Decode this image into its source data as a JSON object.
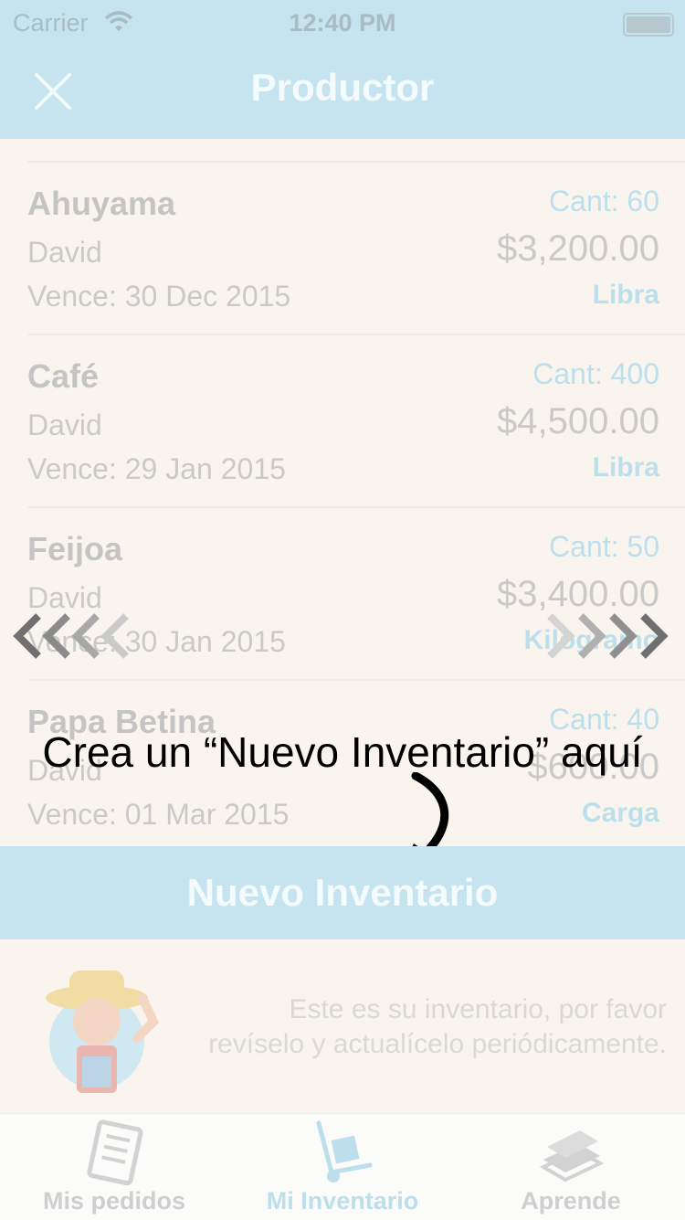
{
  "status_bar": {
    "carrier": "Carrier",
    "time": "12:40 PM"
  },
  "nav": {
    "title": "Productor"
  },
  "inventory": [
    {
      "name": "Ahuyama",
      "owner": "David",
      "expires": "Vence: 30 Dec 2015",
      "quantity": "Cant: 60",
      "price": "$3,200.00",
      "unit": "Libra"
    },
    {
      "name": "Café",
      "owner": "David",
      "expires": "Vence: 29 Jan 2015",
      "quantity": "Cant: 400",
      "price": "$4,500.00",
      "unit": "Libra"
    },
    {
      "name": "Feijoa",
      "owner": "David",
      "expires": "Vence: 30 Jan 2015",
      "quantity": "Cant: 50",
      "price": "$3,400.00",
      "unit": "Kilogramo"
    },
    {
      "name": "Papa Betina",
      "owner": "David",
      "expires": "Vence: 01 Mar 2015",
      "quantity": "Cant: 40",
      "price": "$600.00",
      "unit": "Carga"
    }
  ],
  "tutorial": {
    "hint": "Crea un “Nuevo Inventario” aquí"
  },
  "new_inventory_button": "Nuevo Inventario",
  "info_message": "Este es su inventario, por favor revíselo y actualícelo periódicamente.",
  "tabs": [
    {
      "label": "Mis pedidos",
      "icon": "orders-icon",
      "active": false
    },
    {
      "label": "Mi Inventario",
      "icon": "hand-truck-icon",
      "active": true
    },
    {
      "label": "Aprende",
      "icon": "books-icon",
      "active": false
    }
  ],
  "colors": {
    "nav_bg": "#c6e4ef",
    "accent": "#bcdfeb",
    "page_bg": "#f9f5ee"
  }
}
